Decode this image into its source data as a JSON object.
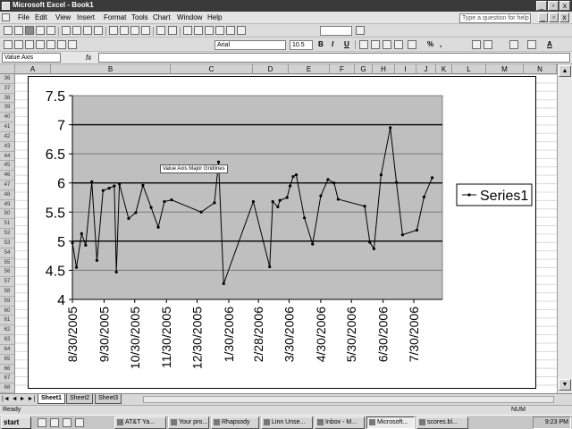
{
  "window": {
    "title": "Microsoft Excel - Book1",
    "min_label": "_",
    "max_label": "▫",
    "close_label": "x"
  },
  "menu": {
    "items": [
      "File",
      "Edit",
      "View",
      "Insert",
      "Format",
      "Tools",
      "Chart",
      "Window",
      "Help"
    ],
    "help_placeholder": "Type a question for help"
  },
  "toolbar": {
    "font_name": "Arial",
    "font_size": "10.5",
    "bold": "B",
    "italic": "I",
    "underline": "U",
    "percent": "%",
    "comma": ",",
    "font_color": "A"
  },
  "formula_bar": {
    "name_box": "Value Axis",
    "fx": "fx",
    "content": ""
  },
  "columns": [
    "A",
    "B",
    "C",
    "D",
    "E",
    "F",
    "G",
    "H",
    "I",
    "J",
    "K",
    "L",
    "M",
    "N"
  ],
  "rows": [
    "36",
    "37",
    "38",
    "39",
    "40",
    "41",
    "42",
    "43",
    "44",
    "45",
    "46",
    "47",
    "48",
    "49",
    "50",
    "51",
    "52",
    "53",
    "54",
    "55",
    "56",
    "57",
    "58",
    "59",
    "60",
    "61",
    "62",
    "63",
    "64",
    "65",
    "66",
    "67",
    "68"
  ],
  "chart_tooltip": "Value Axis Major Gridlines",
  "chart_data": {
    "type": "line",
    "ylim": [
      4,
      7.5
    ],
    "yticks": [
      "4",
      "4.5",
      "5",
      "5.5",
      "6",
      "6.5",
      "7",
      "7.5"
    ],
    "xticks": [
      "8/30/2005",
      "9/30/2005",
      "10/30/2005",
      "11/30/2005",
      "12/30/2005",
      "1/30/2006",
      "2/28/2006",
      "3/30/2006",
      "4/30/2006",
      "5/30/2006",
      "6/30/2006",
      "7/30/2006"
    ],
    "x_range": [
      "8/30/2005",
      "8/27/2006"
    ],
    "legend_position": "right",
    "major_gridlines": true,
    "plot_area_color": "#bfbfbf",
    "series": [
      {
        "name": "Series1",
        "points": [
          {
            "x": "2005-08-30",
            "y": 4.97
          },
          {
            "x": "2005-09-03",
            "y": 4.55
          },
          {
            "x": "2005-09-08",
            "y": 5.13
          },
          {
            "x": "2005-09-12",
            "y": 4.93
          },
          {
            "x": "2005-09-18",
            "y": 6.02
          },
          {
            "x": "2005-09-23",
            "y": 4.67
          },
          {
            "x": "2005-09-29",
            "y": 5.87
          },
          {
            "x": "2005-10-05",
            "y": 5.91
          },
          {
            "x": "2005-10-10",
            "y": 5.95
          },
          {
            "x": "2005-10-12",
            "y": 4.47
          },
          {
            "x": "2005-10-15",
            "y": 5.98
          },
          {
            "x": "2005-10-24",
            "y": 5.39
          },
          {
            "x": "2005-10-31",
            "y": 5.49
          },
          {
            "x": "2005-11-07",
            "y": 5.96
          },
          {
            "x": "2005-11-15",
            "y": 5.58
          },
          {
            "x": "2005-11-22",
            "y": 5.24
          },
          {
            "x": "2005-11-28",
            "y": 5.68
          },
          {
            "x": "2005-12-05",
            "y": 5.71
          },
          {
            "x": "2006-01-03",
            "y": 5.5
          },
          {
            "x": "2006-01-16",
            "y": 5.66
          },
          {
            "x": "2006-01-20",
            "y": 6.36
          },
          {
            "x": "2006-01-25",
            "y": 4.27
          },
          {
            "x": "2006-02-23",
            "y": 5.68
          },
          {
            "x": "2006-03-11",
            "y": 4.56
          },
          {
            "x": "2006-03-14",
            "y": 5.68
          },
          {
            "x": "2006-03-19",
            "y": 5.59
          },
          {
            "x": "2006-03-21",
            "y": 5.7
          },
          {
            "x": "2006-03-28",
            "y": 5.75
          },
          {
            "x": "2006-03-31",
            "y": 5.95
          },
          {
            "x": "2006-04-03",
            "y": 6.11
          },
          {
            "x": "2006-04-06",
            "y": 6.14
          },
          {
            "x": "2006-04-14",
            "y": 5.4
          },
          {
            "x": "2006-04-22",
            "y": 4.95
          },
          {
            "x": "2006-04-30",
            "y": 5.78
          },
          {
            "x": "2006-05-07",
            "y": 6.06
          },
          {
            "x": "2006-05-13",
            "y": 6.0
          },
          {
            "x": "2006-05-17",
            "y": 5.72
          },
          {
            "x": "2006-06-12",
            "y": 5.6
          },
          {
            "x": "2006-06-17",
            "y": 4.98
          },
          {
            "x": "2006-06-21",
            "y": 4.87
          },
          {
            "x": "2006-06-28",
            "y": 6.14
          },
          {
            "x": "2006-07-07",
            "y": 6.95
          },
          {
            "x": "2006-07-13",
            "y": 6.01
          },
          {
            "x": "2006-07-19",
            "y": 5.11
          },
          {
            "x": "2006-08-02",
            "y": 5.19
          },
          {
            "x": "2006-08-09",
            "y": 5.76
          },
          {
            "x": "2006-08-17",
            "y": 6.09
          }
        ]
      }
    ]
  },
  "sheets": {
    "nav": "|◄ ◄ ► ►|",
    "tabs": [
      "Sheet1",
      "Sheet2",
      "Sheet3"
    ],
    "active": "Sheet1"
  },
  "status": {
    "left": "Ready",
    "num": "NUM"
  },
  "taskbar": {
    "start": "start",
    "items": [
      "AT&T Ya...",
      "Your pro...",
      "Rhapsody",
      "Linn Unse...",
      "Inbox - M...",
      "Microsoft...",
      "scores.bl..."
    ],
    "active_index": 5,
    "clock": "9:23 PM"
  }
}
